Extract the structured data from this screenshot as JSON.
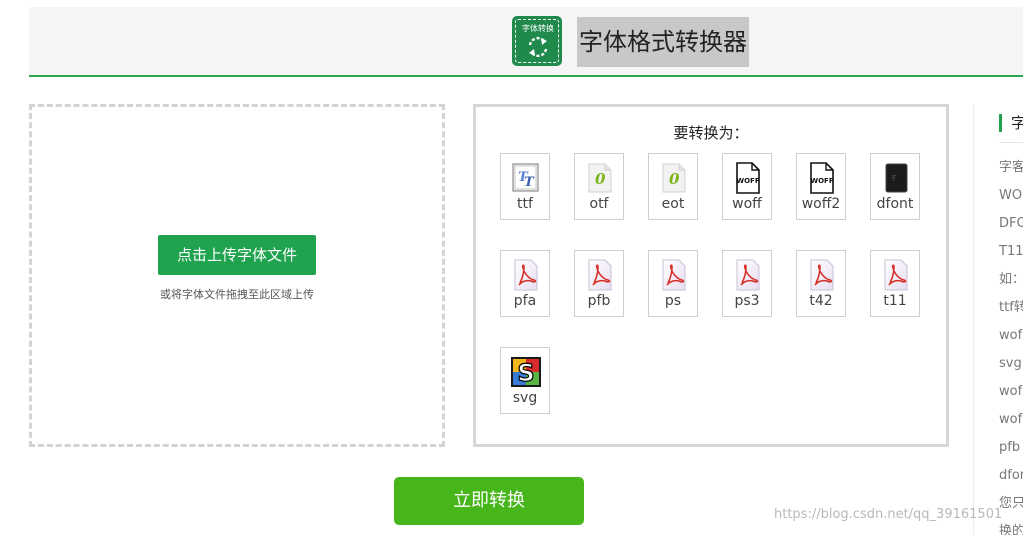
{
  "header": {
    "logo_text": "字体转换",
    "title": "字体格式转换器"
  },
  "upload": {
    "button_label": "点击上传字体文件",
    "hint": "或将字体文件拖拽至此区域上传"
  },
  "formats": {
    "title": "要转换为：",
    "items": [
      {
        "label": "ttf",
        "icon": "truetype-icon"
      },
      {
        "label": "otf",
        "icon": "opentype-icon"
      },
      {
        "label": "eot",
        "icon": "opentype-icon"
      },
      {
        "label": "woff",
        "icon": "woff-file-icon"
      },
      {
        "label": "woff2",
        "icon": "woff-file-icon"
      },
      {
        "label": "dfont",
        "icon": "dfont-file-icon"
      },
      {
        "label": "pfa",
        "icon": "pdf-file-icon"
      },
      {
        "label": "pfb",
        "icon": "pdf-file-icon"
      },
      {
        "label": "ps",
        "icon": "pdf-file-icon"
      },
      {
        "label": "ps3",
        "icon": "pdf-file-icon"
      },
      {
        "label": "t42",
        "icon": "pdf-file-icon"
      },
      {
        "label": "t11",
        "icon": "pdf-file-icon"
      },
      {
        "label": "svg",
        "icon": "svg-s-icon"
      }
    ]
  },
  "convert": {
    "label": "立即转换"
  },
  "sidebar": {
    "title": "字",
    "items": [
      "字客",
      "WO",
      "DFO",
      "T11",
      "如：",
      "ttf转",
      "wof",
      "svg,",
      "wof",
      "wof",
      "pfb",
      "dfor",
      "您只",
      "换的"
    ]
  },
  "watermark": "https://blog.csdn.net/qq_39161501",
  "colors": {
    "brand_green": "#20a34f",
    "convert_green": "#46b61b",
    "header_rule": "#2aa64e"
  }
}
